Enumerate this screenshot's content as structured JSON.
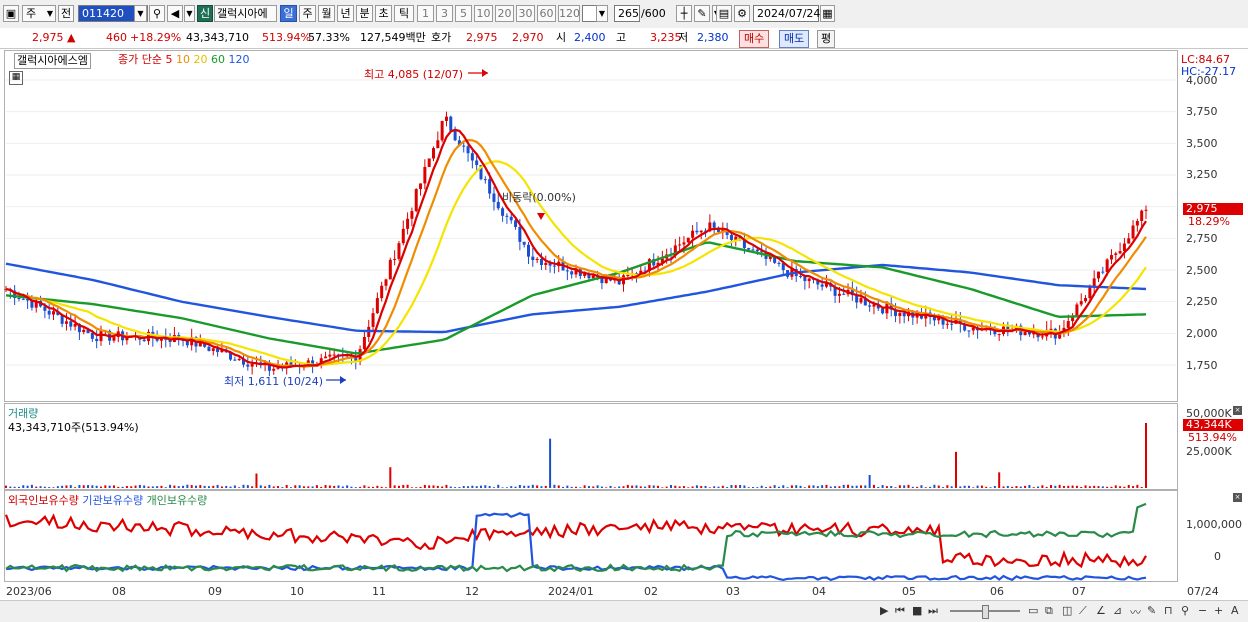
{
  "toolbar": {
    "market_label": "주",
    "prev_label": "전",
    "code": "011420",
    "new_label": "신",
    "stock_name": "갤럭시아에",
    "periods": [
      "일",
      "주",
      "월",
      "년",
      "분",
      "초",
      "틱"
    ],
    "active_period": "일",
    "intervals": [
      "1",
      "3",
      "5",
      "10",
      "20",
      "30",
      "60",
      "120"
    ],
    "count": "265",
    "count_total": "/600",
    "date": "2024/07/24"
  },
  "quote": {
    "price": "2,975",
    "change_arrow": "▲",
    "change": "460",
    "change_pct": "+18.29%",
    "volume": "43,343,710",
    "volume_pct": "513.94%",
    "turnover_pct": "57.33%",
    "amount": "127,549백만",
    "bid_label": "호가",
    "ask": "2,975",
    "bid": "2,970",
    "open_label": "시",
    "open": "2,400",
    "high_label": "고",
    "high": "3,235",
    "low_label": "저",
    "low": "2,380",
    "buy_label": "매수",
    "sell_label": "매도",
    "eq_label": "평"
  },
  "price_panel": {
    "stock_tag": "갤럭시아에스엠",
    "ma_title": "종가 단순",
    "ma_periods": [
      {
        "label": "5",
        "color": "#dd0000"
      },
      {
        "label": "10",
        "color": "#f08c00"
      },
      {
        "label": "20",
        "color": "#e6d000"
      },
      {
        "label": "60",
        "color": "#1a9a2a"
      },
      {
        "label": "120",
        "color": "#2255dd"
      }
    ],
    "high_annotation": "최고 4,085 (12/07)",
    "low_annotation": "최저 1,611 (10/24)",
    "mid_annotation": "비동락(0.00%)",
    "lc": "LC:84.67",
    "hc": "HC:-27.17",
    "yticks": [
      "4,000",
      "3,750",
      "3,500",
      "3,250",
      "2,750",
      "2,500",
      "2,250",
      "2,000",
      "1,750"
    ],
    "current_price_tag": "2,975",
    "current_pct_tag": "18.29%"
  },
  "volume_panel": {
    "title": "거래량",
    "value_line": "43,343,710주(513.94%)",
    "yticks": [
      "50,000K",
      "25,000K"
    ],
    "current_tag": "43,344K",
    "current_pct": "513.94%"
  },
  "holding_panel": {
    "legend": [
      {
        "label": "외국인보유수량",
        "color": "#dd0000"
      },
      {
        "label": "기관보유수량",
        "color": "#2255dd"
      },
      {
        "label": "개인보유수량",
        "color": "#2a8a4a"
      }
    ],
    "yticks": [
      "1,000,000",
      "0"
    ]
  },
  "xaxis": {
    "labels": [
      "2023/06",
      "08",
      "09",
      "10",
      "11",
      "12",
      "2024/01",
      "02",
      "03",
      "04",
      "05",
      "06",
      "07",
      "07/24"
    ]
  },
  "colors": {
    "up": "#dd0000",
    "down": "#1a4fd0",
    "ma5": "#dd0000",
    "ma10": "#f08c00",
    "ma20": "#f5e400",
    "ma60": "#1a9a2a",
    "ma120": "#2255dd"
  },
  "chart_data": {
    "type": "line",
    "title": "",
    "price_ylim": [
      1600,
      4100
    ],
    "x_labels": [
      "2023/06",
      "08",
      "09",
      "10",
      "11",
      "12",
      "2024/01",
      "02",
      "03",
      "04",
      "05",
      "06",
      "07"
    ],
    "close_approx": [
      {
        "x": "2023/06",
        "y": 2350
      },
      {
        "x": "08",
        "y": 1980
      },
      {
        "x": "09",
        "y": 1960
      },
      {
        "x": "10",
        "y": 1720
      },
      {
        "x": "11",
        "y": 1820
      },
      {
        "x": "12",
        "y": 3700
      },
      {
        "x": "2024/01",
        "y": 2600
      },
      {
        "x": "02",
        "y": 2400
      },
      {
        "x": "03",
        "y": 2850
      },
      {
        "x": "04",
        "y": 2450
      },
      {
        "x": "05",
        "y": 2200
      },
      {
        "x": "06",
        "y": 2050
      },
      {
        "x": "07",
        "y": 2000
      },
      {
        "x": "07/24",
        "y": 2975
      }
    ],
    "ma120_approx": [
      {
        "x": "2023/06",
        "y": 2550
      },
      {
        "x": "08",
        "y": 2420
      },
      {
        "x": "09",
        "y": 2250
      },
      {
        "x": "10",
        "y": 2130
      },
      {
        "x": "11",
        "y": 2020
      },
      {
        "x": "12",
        "y": 2010
      },
      {
        "x": "2024/01",
        "y": 2150
      },
      {
        "x": "02",
        "y": 2210
      },
      {
        "x": "03",
        "y": 2330
      },
      {
        "x": "04",
        "y": 2480
      },
      {
        "x": "05",
        "y": 2540
      },
      {
        "x": "06",
        "y": 2480
      },
      {
        "x": "07",
        "y": 2380
      },
      {
        "x": "07/24",
        "y": 2350
      }
    ],
    "ma60_approx": [
      {
        "x": "2023/06",
        "y": 2300
      },
      {
        "x": "08",
        "y": 2230
      },
      {
        "x": "09",
        "y": 2120
      },
      {
        "x": "10",
        "y": 1960
      },
      {
        "x": "11",
        "y": 1840
      },
      {
        "x": "12",
        "y": 1950
      },
      {
        "x": "2024/01",
        "y": 2300
      },
      {
        "x": "02",
        "y": 2480
      },
      {
        "x": "03",
        "y": 2720
      },
      {
        "x": "04",
        "y": 2570
      },
      {
        "x": "05",
        "y": 2520
      },
      {
        "x": "06",
        "y": 2350
      },
      {
        "x": "07",
        "y": 2130
      },
      {
        "x": "07/24",
        "y": 2150
      }
    ],
    "volume_ylim": [
      0,
      60000
    ],
    "volume_last_k": 43344
  }
}
